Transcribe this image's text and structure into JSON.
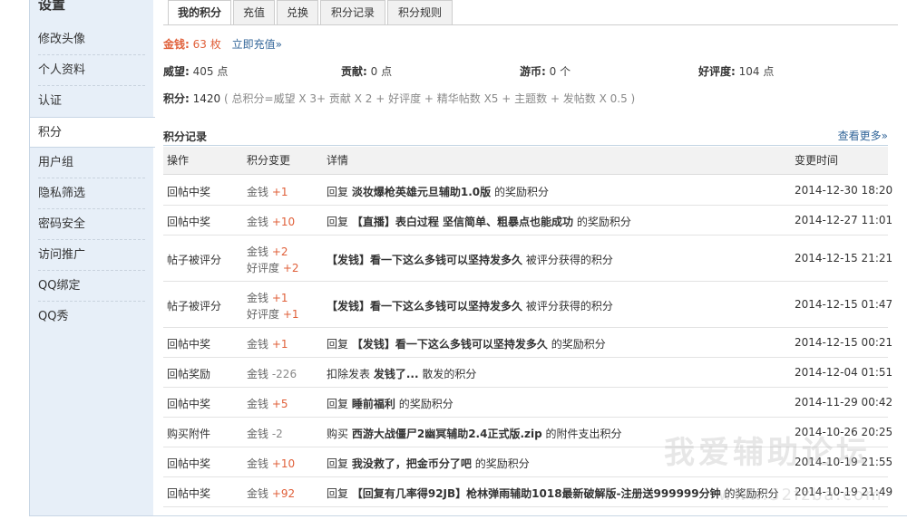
{
  "sidebar": {
    "title": "设置",
    "items": [
      {
        "label": "修改头像"
      },
      {
        "label": "个人资料"
      },
      {
        "label": "认证"
      },
      {
        "label": "积分"
      },
      {
        "label": "用户组"
      },
      {
        "label": "隐私筛选"
      },
      {
        "label": "密码安全"
      },
      {
        "label": "访问推广"
      },
      {
        "label": "QQ绑定"
      },
      {
        "label": "QQ秀"
      }
    ]
  },
  "tabs": [
    "我的积分",
    "充值",
    "兑换",
    "积分记录",
    "积分规则"
  ],
  "money": {
    "label": "金钱:",
    "value": "63 枚",
    "recharge": "立即充值»"
  },
  "stats": {
    "prestige": {
      "label": "威望:",
      "value": "405 点"
    },
    "contribution": {
      "label": "贡献:",
      "value": "0 点"
    },
    "coins": {
      "label": "游币:",
      "value": "0 个"
    },
    "favor": {
      "label": "好评度:",
      "value": "104 点"
    }
  },
  "score": {
    "label": "积分:",
    "value": "1420",
    "formula": "( 总积分=威望 X 3+ 贡献 X 2 + 好评度 + 精华帖数 X5 + 主题数 + 发帖数 X 0.5 )"
  },
  "records": {
    "title": "积分记录",
    "more": "查看更多»",
    "headers": [
      "操作",
      "积分变更",
      "详情",
      "变更时间"
    ],
    "rows": [
      {
        "op": "回帖中奖",
        "c1": "金钱",
        "v1": "+1",
        "c2": "",
        "v2": "",
        "pre": "回复",
        "link": "淡妆爆枪英雄元旦辅助1.0版",
        "post": "的奖励积分",
        "time": "2014-12-30 18:20"
      },
      {
        "op": "回帖中奖",
        "c1": "金钱",
        "v1": "+10",
        "c2": "",
        "v2": "",
        "pre": "回复",
        "link": "【直播】表白过程 坚信简单、粗暴点也能成功",
        "post": "的奖励积分",
        "time": "2014-12-27 11:01"
      },
      {
        "op": "帖子被评分",
        "c1": "金钱",
        "v1": "+2",
        "c2": "好评度",
        "v2": "+2",
        "pre": "",
        "link": "【发钱】看一下这么多钱可以坚持发多久",
        "post": "被评分获得的积分",
        "time": "2014-12-15 21:21"
      },
      {
        "op": "帖子被评分",
        "c1": "金钱",
        "v1": "+1",
        "c2": "好评度",
        "v2": "+1",
        "pre": "",
        "link": "【发钱】看一下这么多钱可以坚持发多久",
        "post": "被评分获得的积分",
        "time": "2014-12-15 01:47"
      },
      {
        "op": "回帖中奖",
        "c1": "金钱",
        "v1": "+1",
        "c2": "",
        "v2": "",
        "pre": "回复",
        "link": "【发钱】看一下这么多钱可以坚持发多久",
        "post": "的奖励积分",
        "time": "2014-12-15 00:21"
      },
      {
        "op": "回帖奖励",
        "c1": "金钱",
        "v1": "-226",
        "c2": "",
        "v2": "",
        "pre": "扣除发表",
        "link": "发钱了...",
        "post": "散发的积分",
        "time": "2014-12-04 01:51"
      },
      {
        "op": "回帖中奖",
        "c1": "金钱",
        "v1": "+5",
        "c2": "",
        "v2": "",
        "pre": "回复",
        "link": "睡前福利",
        "post": "的奖励积分",
        "time": "2014-11-29 00:42"
      },
      {
        "op": "购买附件",
        "c1": "金钱",
        "v1": "-2",
        "c2": "",
        "v2": "",
        "pre": "购买",
        "link": "西游大战僵尸2幽冥辅助2.4正式版.zip",
        "post": "的附件支出积分",
        "time": "2014-10-26 20:25"
      },
      {
        "op": "回帖中奖",
        "c1": "金钱",
        "v1": "+10",
        "c2": "",
        "v2": "",
        "pre": "回复",
        "link": "我没救了，把金币分了吧",
        "post": "的奖励积分",
        "time": "2014-10-19 21:55"
      },
      {
        "op": "回帖中奖",
        "c1": "金钱",
        "v1": "+92",
        "c2": "",
        "v2": "",
        "pre": "回复",
        "link": "【回复有几率得92JB】枪林弹雨辅助1018最新破解版-注册送999999分钟",
        "post": "的奖励积分",
        "time": "2014-10-19 21:49"
      }
    ]
  },
  "watermark": {
    "title": "我爱辅助论坛",
    "url": "www.52fzba.com"
  },
  "colors": {
    "sidebar_bg": "#e7eff8",
    "accent_orange": "#e0603a",
    "link_blue": "#336699"
  }
}
